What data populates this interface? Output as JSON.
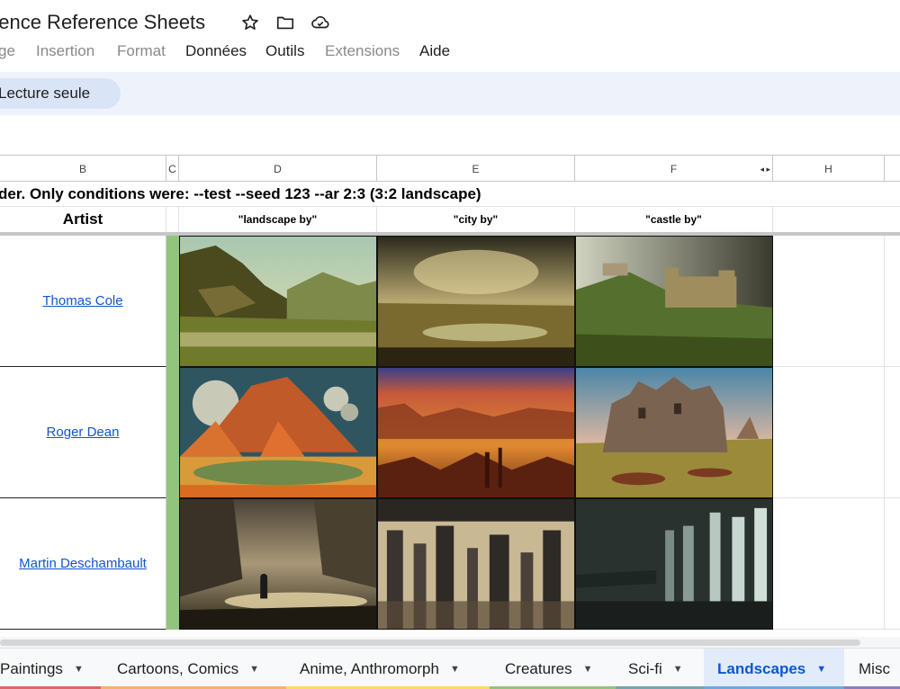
{
  "app": {
    "doc_title": "uence Reference Sheets",
    "icons": [
      "star-icon",
      "folder-icon",
      "cloud-icon"
    ]
  },
  "menu": [
    {
      "label": "ge",
      "enabled": false
    },
    {
      "label": "Insertion",
      "enabled": false
    },
    {
      "label": "Format",
      "enabled": false
    },
    {
      "label": "Données",
      "enabled": true
    },
    {
      "label": "Outils",
      "enabled": true
    },
    {
      "label": "Extensions",
      "enabled": false
    },
    {
      "label": "Aide",
      "enabled": true
    }
  ],
  "toolbar": {
    "readonly_label": "Lecture seule"
  },
  "columns": [
    "B",
    "C",
    "D",
    "E",
    "F",
    "H"
  ],
  "sheet": {
    "row1_text": "der. Only conditions were:  --test --seed 123 --ar 2:3 (3:2 landscape)",
    "headers": {
      "artist": "Artist",
      "d": "\"landscape by\"",
      "e": "\"city by\"",
      "f": "\"castle by\""
    },
    "rows": [
      {
        "artist": "Thomas Cole"
      },
      {
        "artist": "Roger Dean"
      },
      {
        "artist": "Martin Deschambault"
      }
    ]
  },
  "tabs": [
    {
      "label": "Paintings",
      "color": "#e06666",
      "active": false
    },
    {
      "label": "Cartoons, Comics",
      "color": "#f6b26b",
      "active": false
    },
    {
      "label": "Anime, Anthromorph",
      "color": "#ffd966",
      "active": false
    },
    {
      "label": "Creatures",
      "color": "#93c47d",
      "active": false
    },
    {
      "label": "Sci-fi",
      "color": "#76a5af",
      "active": false
    },
    {
      "label": "Landscapes",
      "color": "#6fa8dc",
      "active": true
    },
    {
      "label": "Misc",
      "color": "#8e7cc3",
      "active": false
    }
  ],
  "colors": {
    "accent": "#0b57d0",
    "link": "#1155cc",
    "column_c_fill": "#93c47d",
    "toolbar_bg": "#eef3fb"
  }
}
